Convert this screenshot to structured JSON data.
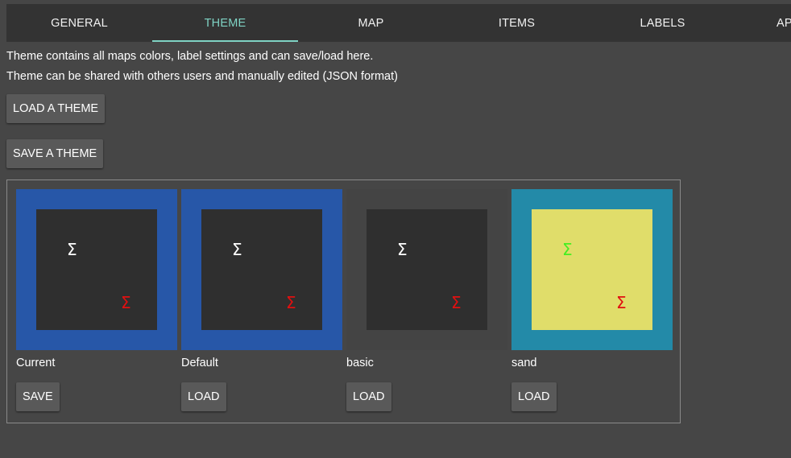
{
  "tabs": [
    {
      "label": "GENERAL",
      "active": false
    },
    {
      "label": "THEME",
      "active": true
    },
    {
      "label": "MAP",
      "active": false
    },
    {
      "label": "ITEMS",
      "active": false
    },
    {
      "label": "LABELS",
      "active": false
    },
    {
      "label": "AP",
      "active": false
    }
  ],
  "colors": {
    "accent": "#7fd3c4",
    "background": "#464646",
    "tabbar": "#333333",
    "button": "#595959"
  },
  "info": {
    "line1": "Theme contains all maps colors, label settings and can save/load here.",
    "line2": "Theme can be shared with others users and manually edited (JSON format)"
  },
  "actions": {
    "load_label": "LOAD A THEME",
    "save_label": "SAVE A THEME"
  },
  "themes": [
    {
      "name": "Current",
      "button": "SAVE",
      "sigma": "Σ",
      "outer": "#2757a8",
      "inner": "#2f2f2f",
      "sigma_a": "#ffffff",
      "sigma_b": "#e01010"
    },
    {
      "name": "Default",
      "button": "LOAD",
      "sigma": "Σ",
      "outer": "#2757a8",
      "inner": "#2f2f2f",
      "sigma_a": "#ffffff",
      "sigma_b": "#e01010"
    },
    {
      "name": "basic",
      "button": "LOAD",
      "sigma": "Σ",
      "outer": "#444444",
      "inner": "#2f2f2f",
      "sigma_a": "#ffffff",
      "sigma_b": "#e01010"
    },
    {
      "name": "sand",
      "button": "LOAD",
      "sigma": "Σ",
      "outer": "#238aa8",
      "inner": "#e0dd6a",
      "sigma_a": "#44ee22",
      "sigma_b": "#e01010"
    }
  ]
}
